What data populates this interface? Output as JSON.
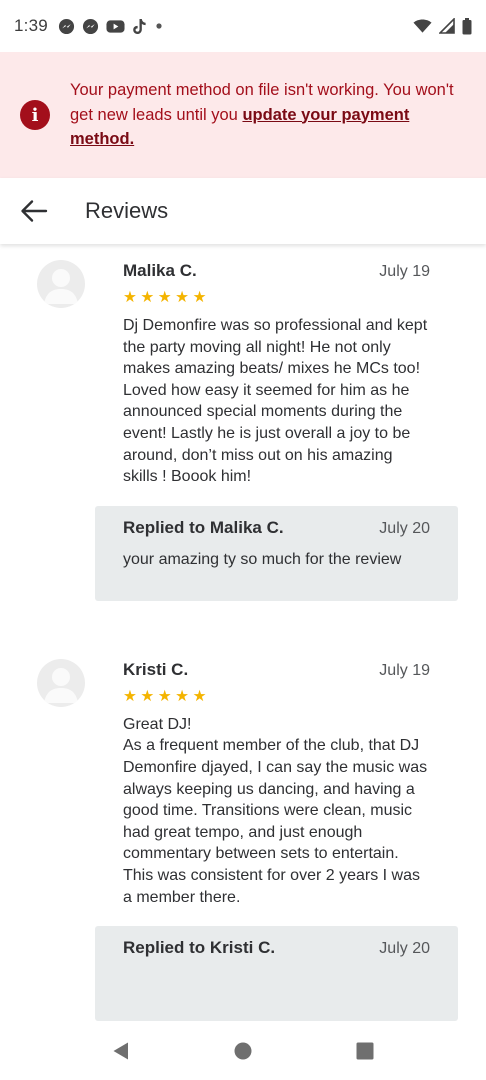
{
  "status_bar": {
    "time": "1:39",
    "notification_icons": [
      "messenger-icon",
      "messenger-icon",
      "youtube-icon",
      "tiktok-icon",
      "dot-icon"
    ],
    "system_icons": [
      "wifi-icon",
      "signal-icon",
      "battery-icon"
    ]
  },
  "banner": {
    "line1": "Your payment method on file isn't working. You won't get new leads until you ",
    "link": "update your payment method.",
    "icon": "alert-icon",
    "color": "#a30f1b",
    "background": "#fde9ea"
  },
  "app_bar": {
    "title": "Reviews",
    "back_icon": "back-arrow-icon"
  },
  "reviews": [
    {
      "name": "Malika C.",
      "date": "July 19",
      "stars": "★★★★★",
      "text": "Dj Demonfire was so professional and kept the party moving all night! He not only makes amazing beats/ mixes he MCs too! Loved how easy it seemed for him as he announced special moments during the event! Lastly he is just overall a joy to be around, don’t miss out on his amazing skills ! Boook him!",
      "reply": {
        "title": "Replied to Malika C.",
        "date": "July 20",
        "text": "your amazing ty so much for the review"
      }
    },
    {
      "name": "Kristi C.",
      "date": "July 19",
      "stars": "★★★★★",
      "text": "Great DJ!\nAs a frequent member of the club, that DJ Demonfire djayed, I can say the music was always keeping us dancing, and having a good time. Transitions were clean, music had great tempo, and just enough commentary between sets to entertain. This was consistent for over 2 years I was a member there.",
      "reply": {
        "title": "Replied to Kristi C.",
        "date": "July 20"
      }
    }
  ],
  "nav_bar": {
    "buttons": [
      "back-triangle-icon",
      "home-circle-icon",
      "recents-square-icon"
    ]
  },
  "colors": {
    "star": "#f4b400",
    "reply_background": "#e8ebec"
  }
}
